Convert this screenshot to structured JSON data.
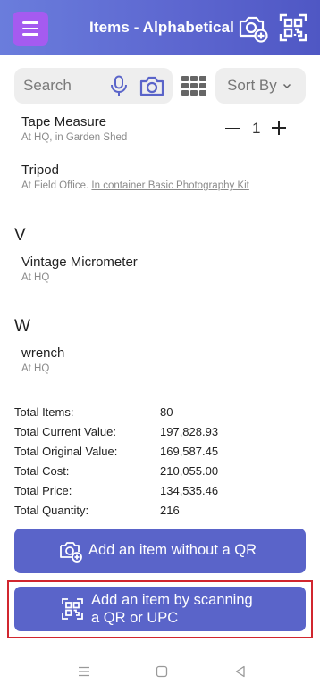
{
  "header": {
    "title": "Items - Alphabetical"
  },
  "search": {
    "placeholder": "Search",
    "sort_label": "Sort By"
  },
  "items_top": [
    {
      "name": "Tape Measure",
      "location": "At HQ, in Garden Shed",
      "quantity": "1"
    },
    {
      "name": "Tripod",
      "location_prefix": "At Field Office.",
      "location_link": "In container Basic Photography Kit"
    }
  ],
  "sections": [
    {
      "letter": "V",
      "items": [
        {
          "name": "Vintage Micrometer",
          "location": "At HQ"
        }
      ]
    },
    {
      "letter": "W",
      "items": [
        {
          "name": "wrench",
          "location": "At HQ"
        }
      ]
    }
  ],
  "totals": [
    {
      "label": "Total Items:",
      "value": "80"
    },
    {
      "label": "Total Current Value:",
      "value": "197,828.93"
    },
    {
      "label": "Total Original Value:",
      "value": "169,587.45"
    },
    {
      "label": "Total Cost:",
      "value": "210,055.00"
    },
    {
      "label": "Total Price:",
      "value": "134,535.46"
    },
    {
      "label": "Total Quantity:",
      "value": "216"
    }
  ],
  "buttons": {
    "add_without_qr": "Add an item without a QR",
    "add_by_scan": "Add an item by scanning\na QR or UPC"
  },
  "colors": {
    "header_start": "#6a7ddc",
    "header_end": "#4f57c4",
    "menu_button": "#a55bf0",
    "action_button": "#5a64c9",
    "highlight": "#d1262f"
  },
  "icons": {
    "menu": "hamburger-icon",
    "header_add_photo": "camera-plus-icon",
    "header_scan": "qr-scan-icon",
    "mic": "mic-icon",
    "camera": "camera-icon",
    "grid": "grid-view-icon",
    "sort_chevron": "chevron-down-icon"
  }
}
